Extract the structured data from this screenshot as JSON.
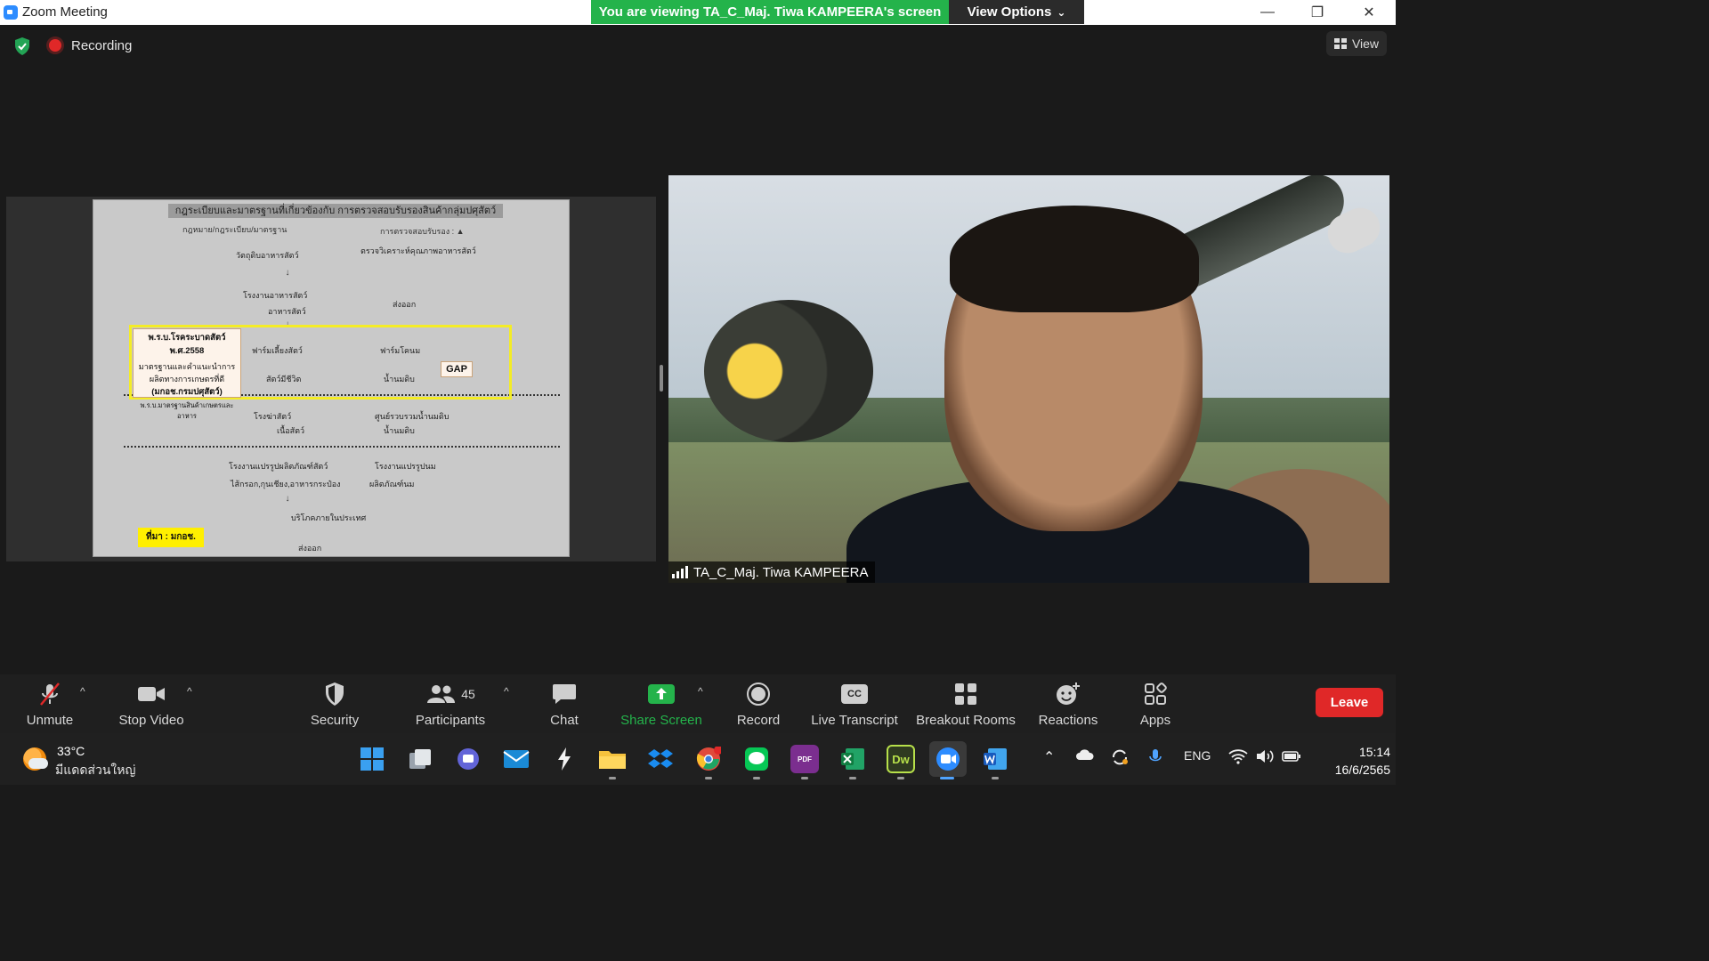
{
  "window": {
    "title": "Zoom Meeting",
    "minimize": "—",
    "restore": "❐",
    "close": "✕"
  },
  "banner": {
    "viewing_text": "You are viewing TA_C_Maj. Tiwa KAMPEERA's screen",
    "view_options_label": "View Options",
    "view_options_caret": "⌄"
  },
  "status": {
    "recording_label": "Recording",
    "view_label": "View"
  },
  "shared_document": {
    "title": "กฎระเบียบและมาตรฐานที่เกี่ยวข้องกับ การตรวจสอบรับรองสินค้ากลุ่มปศุสัตว์",
    "col_law": "กฎหมาย/กฎระเบียบ/มาตรฐาน",
    "col_cert": "การตรวจสอบรับรอง : ▲",
    "callout_law": "พ.ร.บ.โรคระบาดสัตว์",
    "callout_year": "พ.ศ.2558",
    "callout_standard": "มาตรฐานและคำแนะนำการผลิตทางการเกษตรที่ดี",
    "callout_agency": "(มกอช.กรมปศุสัตว์)",
    "callout_footer": "พ.ร.บ.มาตรฐานสินค้าเกษตรและอาหาร",
    "gap_label": "GAP",
    "source_label": "ที่มา : มกอช.",
    "rows": [
      {
        "left": "วัตถุดิบอาหารสัตว์",
        "right": "ตรวจวิเคราะห์คุณภาพอาหารสัตว์"
      },
      {
        "left": "โรงงานอาหารสัตว์",
        "right": "ส่งออก"
      },
      {
        "left": "อาหารสัตว์",
        "right": ""
      },
      {
        "left": "ฟาร์มเลี้ยงสัตว์",
        "right": "ฟาร์มโคนม"
      },
      {
        "left": "สัตว์มีชีวิต",
        "right": "น้ำนมดิบ"
      },
      {
        "left": "โรงฆ่าสัตว์",
        "right": "ศูนย์รวบรวมน้ำนมดิบ"
      },
      {
        "left": "เนื้อสัตว์",
        "right": "น้ำนมดิบ"
      },
      {
        "left": "โรงงานแปรรูปผลิตภัณฑ์สัตว์",
        "right": "โรงงานแปรรูปนม"
      },
      {
        "left": "ไส้กรอก,กุนเชียง,อาหารกระป๋อง",
        "right": "ผลิตภัณฑ์นม"
      },
      {
        "left": "บริโภคภายในประเทศ",
        "right": ""
      },
      {
        "left": "ส่งออก",
        "right": ""
      }
    ],
    "arrow": "↓"
  },
  "participant": {
    "name": "TA_C_Maj. Tiwa KAMPEERA"
  },
  "toolbar": {
    "unmute": "Unmute",
    "stop_video": "Stop Video",
    "security": "Security",
    "participants": "Participants",
    "participants_count": "45",
    "chat": "Chat",
    "share_screen": "Share Screen",
    "record": "Record",
    "live_transcript": "Live Transcript",
    "cc": "CC",
    "breakout_rooms": "Breakout Rooms",
    "reactions": "Reactions",
    "apps": "Apps",
    "leave": "Leave",
    "caret": "^"
  },
  "taskbar": {
    "temperature": "33°C",
    "weather_desc": "มีแดดส่วนใหญ่",
    "language": "ENG",
    "time": "15:14",
    "date": "16/6/2565",
    "dreamweaver": "Dw",
    "pdf": "PDF"
  },
  "colors": {
    "banner_green": "#24b34b",
    "leave_red": "#e02828",
    "share_green": "#24b34b",
    "zoom_blue": "#2d8cff"
  },
  "icons": [
    "zoom-icon",
    "shield-icon",
    "recording-icon",
    "view-icon",
    "mic-muted-icon",
    "video-icon",
    "security-icon",
    "participants-icon",
    "chat-icon",
    "share-screen-icon",
    "record-icon",
    "cc-icon",
    "breakout-icon",
    "reactions-icon",
    "apps-icon",
    "windows-start-icon"
  ]
}
